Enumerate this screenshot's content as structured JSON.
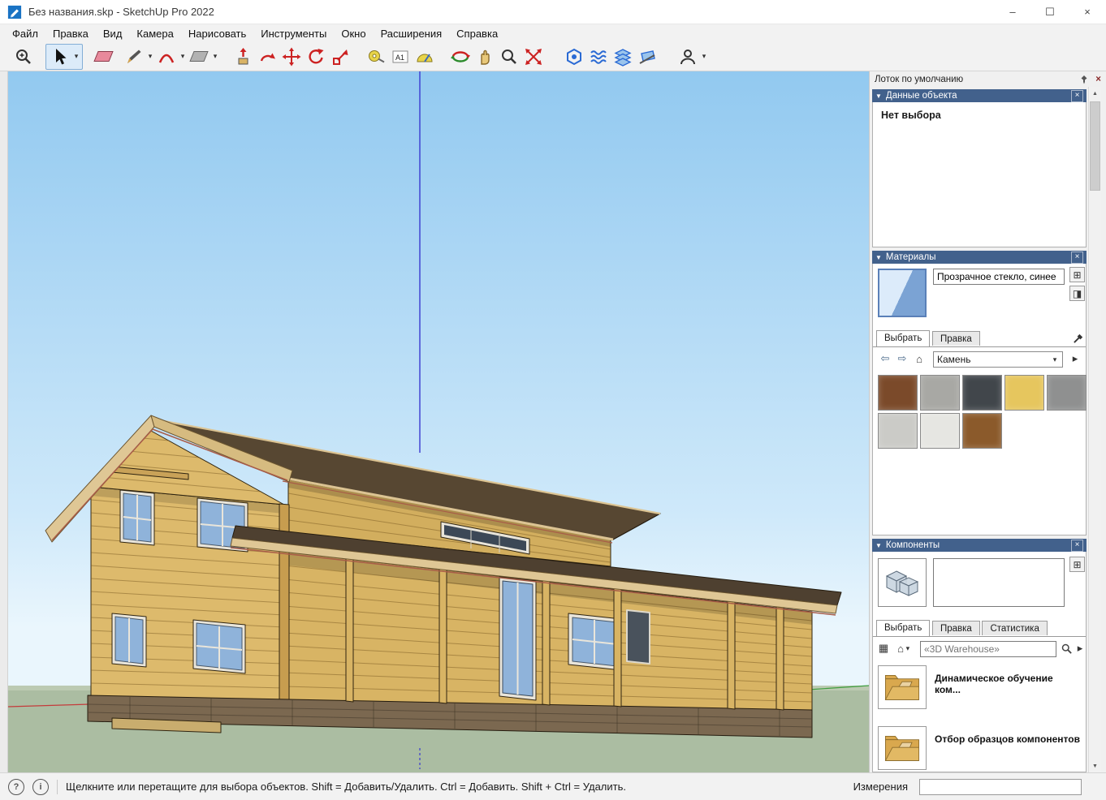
{
  "colors": {
    "panel_header": "#42618c",
    "sky_top": "#92c9f0",
    "ground": "#abbda2",
    "wall_tan": "#d8b464",
    "roof_brown": "#574732",
    "axis_blue": "#3a3ad0",
    "axis_red": "#c43b3b",
    "axis_green": "#3f9e3f",
    "selection_box_blue": "#84aed6"
  },
  "window": {
    "title": "Без названия.skp - SketchUp Pro 2022",
    "controls": {
      "minimize": "–",
      "maximize": "☐",
      "close": "×"
    }
  },
  "menubar": {
    "items": [
      "Файл",
      "Правка",
      "Вид",
      "Камера",
      "Нарисовать",
      "Инструменты",
      "Окно",
      "Расширения",
      "Справка"
    ]
  },
  "toolbar": {
    "tools": [
      "zoom-window",
      "select",
      "eraser",
      "line",
      "arc",
      "rectangle",
      "push-pull",
      "follow-me",
      "move",
      "rotate",
      "scale",
      "tape-measure",
      "text",
      "protractor",
      "orbit",
      "pan",
      "zoom",
      "zoom-extents",
      "position-camera",
      "soften-edges",
      "layers",
      "section-plane",
      "account"
    ]
  },
  "icons": {
    "close": "×",
    "collapse": "▼",
    "dropdown": "▾",
    "back": "⇦",
    "forward": "⇨",
    "home": "⌂",
    "new_item": "⊞",
    "secondary_pane": "◨",
    "view_options": "▦",
    "detail_arrow": "▸",
    "scroll_up": "▲",
    "scroll_down": "▼",
    "help": "?",
    "info": "i"
  },
  "tray": {
    "title": "Лоток по умолчанию",
    "panels": {
      "entity_info": {
        "title": "Данные объекта",
        "empty_text": "Нет выбора"
      },
      "materials": {
        "title": "Материалы",
        "material_name": "Прозрачное стекло, синее",
        "tabs": [
          "Выбрать",
          "Правка"
        ],
        "active_tab": "Выбрать",
        "collection": "Камень",
        "swatches": [
          {
            "name": "stone-brown-granite",
            "color": "#7b4a2a"
          },
          {
            "name": "stone-gray-granite",
            "color": "#a8a8a4"
          },
          {
            "name": "stone-dark-granite",
            "color": "#41464b"
          },
          {
            "name": "stone-yellow-travertine",
            "color": "#e6c65e"
          },
          {
            "name": "stone-gray",
            "color": "#8f9090"
          },
          {
            "name": "stone-light-marble",
            "color": "#cbcbc7"
          },
          {
            "name": "stone-white-marble",
            "color": "#e6e6e2"
          },
          {
            "name": "stone-brown",
            "color": "#8b5a2b"
          }
        ]
      },
      "components": {
        "title": "Компоненты",
        "tabs": [
          "Выбрать",
          "Правка",
          "Статистика"
        ],
        "active_tab": "Выбрать",
        "search_placeholder": "«3D Warehouse»",
        "items": [
          {
            "label": "Динамическое обучение ком..."
          },
          {
            "label": "Отбор образцов компонентов"
          }
        ]
      }
    }
  },
  "statusbar": {
    "hint": "Щелкните или перетащите для выбора объектов. Shift = Добавить/Удалить. Ctrl = Добавить. Shift + Ctrl = Удалить.",
    "measurements_label": "Измерения",
    "measurements_value": ""
  }
}
